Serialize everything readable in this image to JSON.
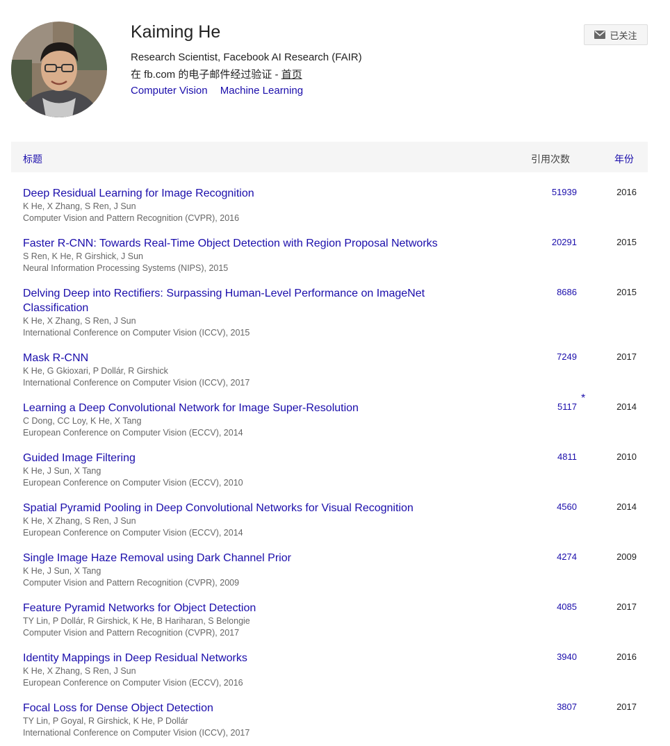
{
  "profile": {
    "name": "Kaiming He",
    "affiliation": "Research Scientist, Facebook AI Research (FAIR)",
    "verified_text": "在 fb.com 的电子邮件经过验证 - ",
    "homepage_label": "首页",
    "interests": [
      "Computer Vision",
      "Machine Learning"
    ],
    "follow_label": "已关注"
  },
  "table": {
    "col_title": "标题",
    "col_cited": "引用次数",
    "col_year": "年份",
    "rows": [
      {
        "title": "Deep Residual Learning for Image Recognition",
        "authors": "K He, X Zhang, S Ren, J Sun",
        "venue": "Computer Vision and Pattern Recognition (CVPR), 2016",
        "cited": "51939",
        "year": "2016"
      },
      {
        "title": "Faster R-CNN: Towards Real-Time Object Detection with Region Proposal Networks",
        "authors": "S Ren, K He, R Girshick, J Sun",
        "venue": "Neural Information Processing Systems (NIPS), 2015",
        "cited": "20291",
        "year": "2015"
      },
      {
        "title": "Delving Deep into Rectifiers: Surpassing Human-Level Performance on ImageNet Classification",
        "authors": "K He, X Zhang, S Ren, J Sun",
        "venue": "International Conference on Computer Vision (ICCV), 2015",
        "cited": "8686",
        "year": "2015"
      },
      {
        "title": "Mask R-CNN",
        "authors": "K He, G Gkioxari, P Dollár, R Girshick",
        "venue": "International Conference on Computer Vision (ICCV), 2017",
        "cited": "7249",
        "year": "2017"
      },
      {
        "title": "Learning a Deep Convolutional Network for Image Super-Resolution",
        "authors": "C Dong, CC Loy, K He, X Tang",
        "venue": "European Conference on Computer Vision (ECCV), 2014",
        "cited": "5117",
        "star": "*",
        "year": "2014"
      },
      {
        "title": "Guided Image Filtering",
        "authors": "K He, J Sun, X Tang",
        "venue": "European Conference on Computer Vision (ECCV), 2010",
        "cited": "4811",
        "year": "2010"
      },
      {
        "title": "Spatial Pyramid Pooling in Deep Convolutional Networks for Visual Recognition",
        "authors": "K He, X Zhang, S Ren, J Sun",
        "venue": "European Conference on Computer Vision (ECCV), 2014",
        "cited": "4560",
        "year": "2014"
      },
      {
        "title": "Single Image Haze Removal using Dark Channel Prior",
        "authors": "K He, J Sun, X Tang",
        "venue": "Computer Vision and Pattern Recognition (CVPR), 2009",
        "cited": "4274",
        "year": "2009"
      },
      {
        "title": "Feature Pyramid Networks for Object Detection",
        "authors": "TY Lin, P Dollár, R Girshick, K He, B Hariharan, S Belongie",
        "venue": "Computer Vision and Pattern Recognition (CVPR), 2017",
        "cited": "4085",
        "year": "2017"
      },
      {
        "title": "Identity Mappings in Deep Residual Networks",
        "authors": "K He, X Zhang, S Ren, J Sun",
        "venue": "European Conference on Computer Vision (ECCV), 2016",
        "cited": "3940",
        "year": "2016"
      },
      {
        "title": "Focal Loss for Dense Object Detection",
        "authors": "TY Lin, P Goyal, R Girshick, K He, P Dollár",
        "venue": "International Conference on Computer Vision (ICCV), 2017",
        "cited": "3807",
        "year": "2017"
      }
    ]
  },
  "colors": {
    "link": "#1a0dab",
    "meta": "#666666",
    "header_bg": "#f5f5f5"
  },
  "icons": {
    "follow": "mail-icon"
  }
}
